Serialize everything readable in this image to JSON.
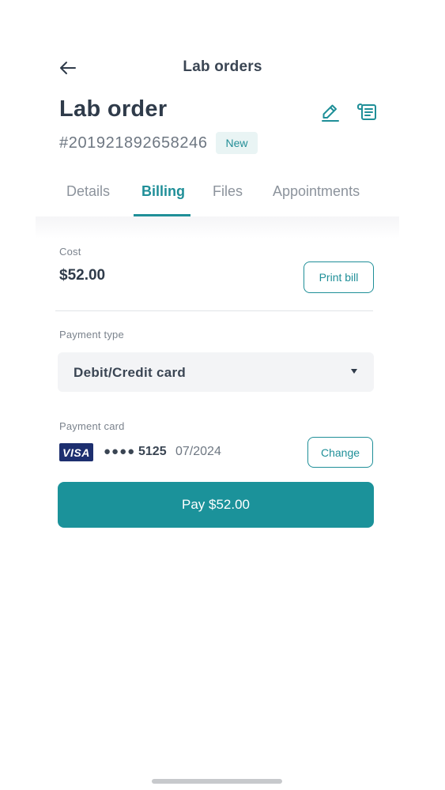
{
  "header": {
    "nav_title": "Lab orders",
    "title": "Lab order",
    "order_number": "#201921892658246",
    "status": "New"
  },
  "tabs": [
    {
      "label": "Details",
      "active": false
    },
    {
      "label": "Billing",
      "active": true
    },
    {
      "label": "Files",
      "active": false
    },
    {
      "label": "Appointments",
      "active": false
    }
  ],
  "billing": {
    "cost_label": "Cost",
    "cost_value": "$52.00",
    "print_label": "Print bill",
    "payment_type_label": "Payment type",
    "payment_type_value": "Debit/Credit card",
    "payment_card_label": "Payment card",
    "card_brand": "VISA",
    "card_mask": "●●●●",
    "card_last4": "5125",
    "card_expiry": "07/2024",
    "change_label": "Change",
    "pay_label": "Pay $52.00"
  },
  "icons": {
    "back": "arrow-left-icon",
    "edit": "pencil-icon",
    "document": "document-icon",
    "caret": "caret-down-icon"
  },
  "colors": {
    "accent": "#1f8f98",
    "pay_button": "#1b929a",
    "badge_bg": "#e9f4f4",
    "visa_blue": "#1d2f6f"
  }
}
